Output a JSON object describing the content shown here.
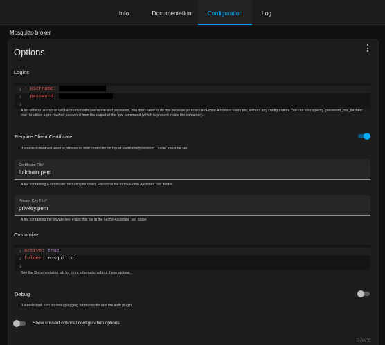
{
  "tabs": [
    {
      "label": "Info"
    },
    {
      "label": "Documentation"
    },
    {
      "label": "Configuration"
    },
    {
      "label": "Log"
    }
  ],
  "active_tab": "Configuration",
  "section_title": "Mosquitto broker",
  "options": {
    "title": "Options",
    "logins": {
      "heading": "Logins",
      "code": {
        "line_numbers": [
          "1",
          "2",
          "3"
        ],
        "dash": "- ",
        "username_key": "username:",
        "password_key": "password:"
      },
      "help": "A list of local users that will be created with username and password. You don't need to do this because you can use Home Assistant users too, without any configuration. You can also specify `password_pre_hashed: true` to utilize a pre-hashed password from the output of the `pw` command (which is present inside the container)."
    },
    "require_client_certificate": {
      "label": "Require Client Certificate",
      "enabled": true,
      "help": "If enabled client will need to provide its own certificate on top of username/password. `cafile` must be set."
    },
    "certfile": {
      "label": "Certificate File*",
      "value": "fullchain.pem",
      "help": "A file containing a certificate, including its chain. Place this file in the Home Assistant `ssl` folder."
    },
    "keyfile": {
      "label": "Private Key File*",
      "value": "privkey.pem",
      "help": "A file containing the private key. Place this file in the Home Assistant `ssl` folder."
    },
    "customize": {
      "heading": "Customize",
      "code": {
        "line_numbers": [
          "1",
          "2",
          "3"
        ],
        "active_key": "active:",
        "active_value": "true",
        "folder_key": "folder:",
        "folder_value": "mosquitto"
      },
      "help": "See the Documentation tab for more information about these options."
    },
    "debug": {
      "label": "Debug",
      "enabled": false,
      "help": "If enabled will turn on debug logging for mosquitto and the auth plugin."
    },
    "show_unused": {
      "label": "Show unused optional configuration options",
      "enabled": false
    },
    "save_label": "SAVE"
  },
  "colors": {
    "accent": "#03a9f4",
    "toggle_on_track": "#0b5d87",
    "toggle_off_track": "#5a5a5a",
    "toggle_off_knob": "#bdbdbd",
    "yaml_key": "#e05a52",
    "yaml_bool": "#b58ad6"
  },
  "icons": {
    "menu": "dots-vertical-icon"
  }
}
